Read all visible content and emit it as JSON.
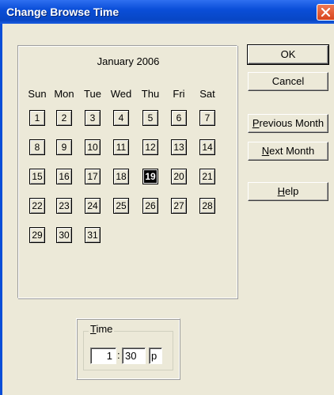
{
  "window": {
    "title": "Change Browse Time",
    "close_icon": "close-icon"
  },
  "calendar": {
    "month_label": "January 2006",
    "weekdays": [
      "Sun",
      "Mon",
      "Tue",
      "Wed",
      "Thu",
      "Fri",
      "Sat"
    ],
    "days": [
      "1",
      "2",
      "3",
      "4",
      "5",
      "6",
      "7",
      "8",
      "9",
      "10",
      "11",
      "12",
      "13",
      "14",
      "15",
      "16",
      "17",
      "18",
      "19",
      "20",
      "21",
      "22",
      "23",
      "24",
      "25",
      "26",
      "27",
      "28",
      "29",
      "30",
      "31"
    ],
    "selected_day": "19"
  },
  "buttons": {
    "ok": "OK",
    "cancel": "Cancel",
    "previous_month": "Previous Month",
    "next_month": "Next Month",
    "help": "Help"
  },
  "time": {
    "group_label": "Time",
    "hour": "1",
    "separator": ":",
    "minute": "30",
    "ampm": "p"
  },
  "colors": {
    "titlebar": "#0a4ed8",
    "dialog_bg": "#ece9d8",
    "close_button": "#d8441c"
  }
}
